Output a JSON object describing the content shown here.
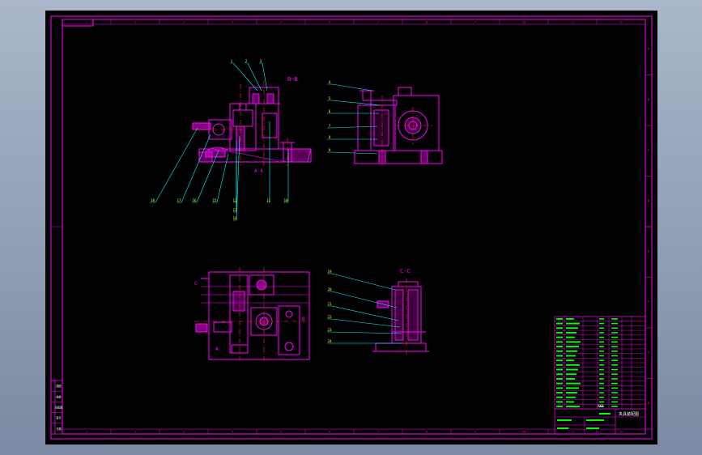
{
  "colors": {
    "background_gradient_top": "#a7b3c6",
    "background_gradient_bottom": "#7d8aa3",
    "canvas": "#000000",
    "border": "#ff00ff",
    "geometry": "#ff00ff",
    "leader": "#00ffff",
    "centerline": "#ff3030",
    "text_yellow": "#ffff00",
    "text_white": "#ffffff",
    "green": "#00ff00"
  },
  "views": {
    "section_bb_label": "B-B",
    "section_aa_label": "A-A",
    "section_cc_label": "C-C",
    "view_a_label": "A",
    "view_b_label": "B",
    "view_c_label": "C"
  },
  "balloons": {
    "section_top": [
      "1",
      "2",
      "3"
    ],
    "section_bottom": [
      "18",
      "17",
      "16",
      "15",
      "12",
      "13",
      "14",
      "11",
      "10"
    ],
    "side_view": [
      "4",
      "5",
      "6",
      "7",
      "8",
      "9"
    ],
    "cc_view": [
      "19",
      "20",
      "21",
      "22",
      "23",
      "24"
    ]
  },
  "border_ticks_top": [
    "1",
    "2",
    "3",
    "4",
    "5",
    "6",
    "7",
    "8",
    "9",
    "10",
    "11",
    "12"
  ],
  "border_ticks_right": [
    "A",
    "B",
    "C",
    "D",
    "E",
    "F",
    "G",
    "H"
  ],
  "title_block": {
    "drawing_title": "夹具装配图",
    "material_note": "XXX",
    "parts_rows": 20
  },
  "left_revision_block": {
    "rows": [
      "描图",
      "描校",
      "旧底图",
      "签字",
      "日期"
    ]
  }
}
